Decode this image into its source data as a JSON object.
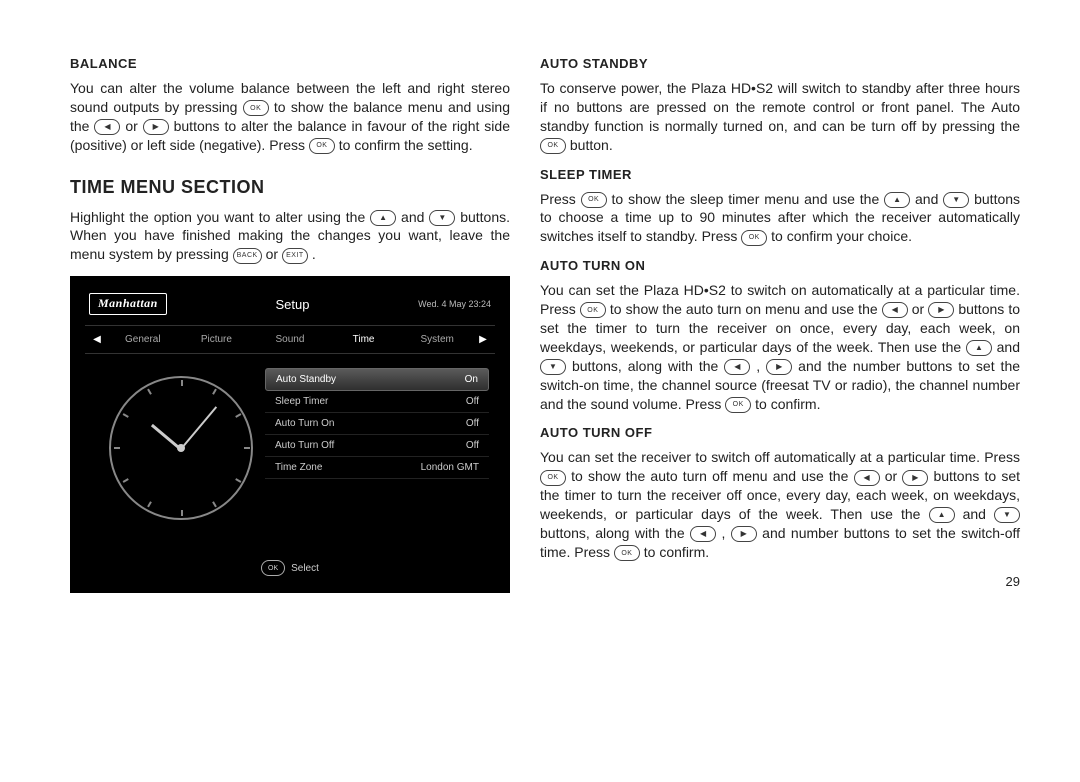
{
  "left": {
    "balance_heading": "BALANCE",
    "balance_p1_a": "You can alter the volume balance between the left and right stereo sound outputs by pressing ",
    "balance_p1_b": " to show the balance menu and using the ",
    "balance_p1_c": " or ",
    "balance_p1_d": " buttons to alter the balance in favour of the right side (positive) or left side (negative). Press ",
    "balance_p1_e": " to confirm the setting.",
    "time_heading": "TIME MENU SECTION",
    "time_p1_a": "Highlight the option you want to alter using the ",
    "time_p1_b": " and ",
    "time_p1_c": " buttons. When you have finished making the changes you want, leave the menu system by pressing ",
    "time_p1_d": " or ",
    "time_p1_e": "."
  },
  "right": {
    "auto_standby_heading": "AUTO STANDBY",
    "auto_standby_p1_a": "To conserve power, the Plaza HD•S2 will switch to standby after three hours if no buttons are pressed on the remote control or front panel. The Auto standby function is normally turned on, and can be turn off by pressing the ",
    "auto_standby_p1_b": " button.",
    "sleep_heading": "SLEEP TIMER",
    "sleep_p1_a": "Press ",
    "sleep_p1_b": " to show the sleep timer menu and use the ",
    "sleep_p1_c": " and ",
    "sleep_p1_d": " buttons to choose a time up to 90 minutes after which the receiver automatically switches itself to standby. Press ",
    "sleep_p1_e": " to confirm your choice.",
    "auto_on_heading": "AUTO TURN ON",
    "auto_on_p1_a": "You can set the Plaza HD•S2 to switch on automatically at a particular time. Press ",
    "auto_on_p1_b": " to show the auto turn on menu and use the ",
    "auto_on_p1_c": " or ",
    "auto_on_p1_d": " buttons to set the timer to turn the receiver on once, every day, each week, on weekdays, weekends, or particular days of the week. Then use the ",
    "auto_on_p1_e": " and ",
    "auto_on_p1_f": " buttons, along with the ",
    "auto_on_p1_g": ", ",
    "auto_on_p1_h": " and the number buttons to set the switch-on time, the channel source (freesat TV or radio), the channel number and the sound volume. Press ",
    "auto_on_p1_i": " to confirm.",
    "auto_off_heading": "AUTO TURN OFF",
    "auto_off_p1_a": "You can set the receiver to switch off automatically at a particular time. Press ",
    "auto_off_p1_b": " to show the auto turn off menu and use the ",
    "auto_off_p1_c": " or ",
    "auto_off_p1_d": " buttons to set the timer to turn the receiver off once, every day, each week, on weekdays, weekends, or particular days of the week. Then use the ",
    "auto_off_p1_e": " and ",
    "auto_off_p1_f": " buttons, along with the ",
    "auto_off_p1_g": ", ",
    "auto_off_p1_h": " and number buttons to set the switch-off time.  Press ",
    "auto_off_p1_i": " to confirm."
  },
  "icons": {
    "ok": "OK",
    "back": "BACK",
    "exit": "EXIT",
    "left": "◀",
    "right": "▶",
    "up": "▲",
    "down": "▼"
  },
  "tv": {
    "logo": "Manhattan",
    "title": "Setup",
    "date": "Wed. 4 May  23:24",
    "tabs": [
      "General",
      "Picture",
      "Sound",
      "Time",
      "System"
    ],
    "active_tab": 3,
    "rows": [
      {
        "label": "Auto Standby",
        "value": "On",
        "highlight": true
      },
      {
        "label": "Sleep Timer",
        "value": "Off"
      },
      {
        "label": "Auto Turn On",
        "value": "Off"
      },
      {
        "label": "Auto Turn Off",
        "value": "Off"
      },
      {
        "label": "Time Zone",
        "value": "London GMT"
      }
    ],
    "footer_ok": "OK",
    "footer_text": "Select"
  },
  "page_number": "29"
}
